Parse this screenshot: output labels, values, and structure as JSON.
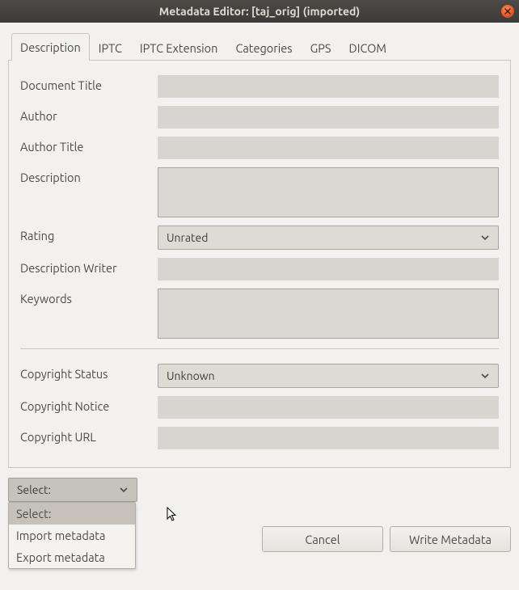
{
  "window": {
    "title": "Metadata Editor: [taj_orig] (imported)"
  },
  "tabs": [
    {
      "label": "Description",
      "active": true
    },
    {
      "label": "IPTC"
    },
    {
      "label": "IPTC Extension"
    },
    {
      "label": "Categories"
    },
    {
      "label": "GPS"
    },
    {
      "label": "DICOM"
    }
  ],
  "form": {
    "document_title_label": "Document Title",
    "document_title_value": "",
    "author_label": "Author",
    "author_value": "",
    "author_title_label": "Author Title",
    "author_title_value": "",
    "description_label": "Description",
    "description_value": "",
    "rating_label": "Rating",
    "rating_value": "Unrated",
    "description_writer_label": "Description Writer",
    "description_writer_value": "",
    "keywords_label": "Keywords",
    "keywords_value": "",
    "copyright_status_label": "Copyright Status",
    "copyright_status_value": "Unknown",
    "copyright_notice_label": "Copyright Notice",
    "copyright_notice_value": "",
    "copyright_url_label": "Copyright URL",
    "copyright_url_value": ""
  },
  "select_dropdown": {
    "button_label": "Select:",
    "options": [
      "Select:",
      "Import metadata",
      "Export metadata"
    ]
  },
  "buttons": {
    "cancel": "Cancel",
    "write_metadata": "Write Metadata"
  }
}
